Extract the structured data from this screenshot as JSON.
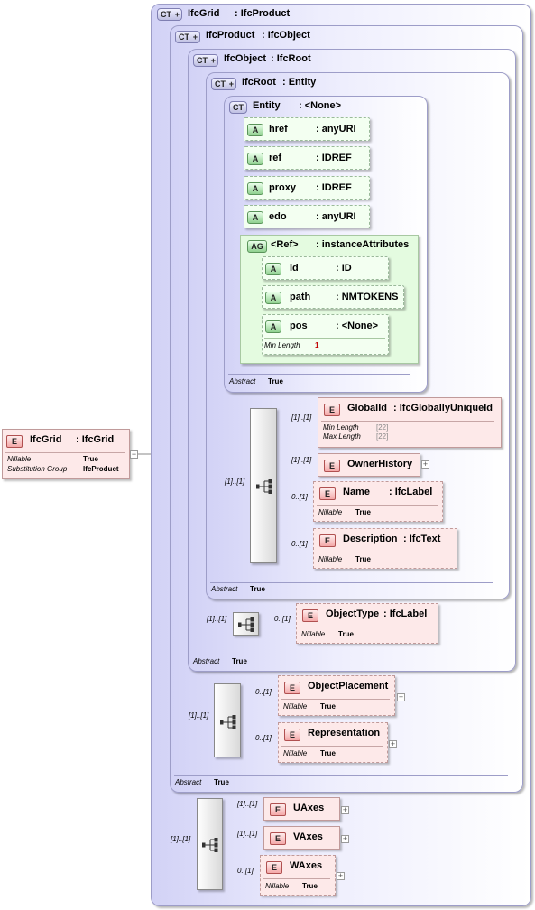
{
  "root_element": {
    "badge": "E",
    "name": "IfcGrid",
    "type": ": IfcGrid",
    "props": [
      {
        "label": "Nillable",
        "value": "True"
      },
      {
        "label": "Substitution Group",
        "value": "IfcProduct"
      }
    ]
  },
  "complex_types": {
    "ifcgrid": {
      "badge": "CT",
      "title": "IfcGrid",
      "base": ": IfcProduct"
    },
    "ifcproduct": {
      "badge": "CT",
      "title": "IfcProduct",
      "base": ": IfcObject",
      "abstract_label": "Abstract",
      "abstract_value": "True"
    },
    "ifcobject": {
      "badge": "CT",
      "title": "IfcObject",
      "base": ": IfcRoot",
      "abstract_label": "Abstract",
      "abstract_value": "True"
    },
    "ifcroot": {
      "badge": "CT",
      "title": "IfcRoot",
      "base": ": Entity",
      "abstract_label": "Abstract",
      "abstract_value": "True"
    },
    "entity": {
      "badge": "CT",
      "title": "Entity",
      "base": ": <None>",
      "abstract_label": "Abstract",
      "abstract_value": "True"
    }
  },
  "entity_attributes": [
    {
      "badge": "A",
      "name": "href",
      "type": ": anyURI"
    },
    {
      "badge": "A",
      "name": "ref",
      "type": ": IDREF"
    },
    {
      "badge": "A",
      "name": "proxy",
      "type": ": IDREF"
    },
    {
      "badge": "A",
      "name": "edo",
      "type": ": anyURI"
    }
  ],
  "attribute_group": {
    "badge": "AG",
    "name": "<Ref>",
    "type": ": instanceAttributes",
    "attributes": [
      {
        "badge": "A",
        "name": "id",
        "type": ": ID"
      },
      {
        "badge": "A",
        "name": "path",
        "type": ": NMTOKENS"
      },
      {
        "badge": "A",
        "name": "pos",
        "type": ": <None>",
        "prop_label": "Min Length",
        "prop_value": "1"
      }
    ]
  },
  "ifcroot_sequence": {
    "cardinality": "[1]..[1]",
    "elements": [
      {
        "badge": "E",
        "card": "[1]..[1]",
        "name": "GlobalId",
        "type": ": IfcGloballyUniqueId",
        "props": [
          {
            "label": "Min Length",
            "value": "[22]"
          },
          {
            "label": "Max Length",
            "value": "[22]"
          }
        ]
      },
      {
        "badge": "E",
        "card": "[1]..[1]",
        "name": "OwnerHistory",
        "expand": "+"
      },
      {
        "badge": "E",
        "card": "0..[1]",
        "name": "Name",
        "type": ": IfcLabel",
        "props": [
          {
            "label": "Nillable",
            "value": "True"
          }
        ]
      },
      {
        "badge": "E",
        "card": "0..[1]",
        "name": "Description",
        "type": ": IfcText",
        "props": [
          {
            "label": "Nillable",
            "value": "True"
          }
        ]
      }
    ]
  },
  "ifcobject_sequence": {
    "cardinality": "[1]..[1]",
    "elements": [
      {
        "badge": "E",
        "card": "0..[1]",
        "name": "ObjectType",
        "type": ": IfcLabel",
        "props": [
          {
            "label": "Nillable",
            "value": "True"
          }
        ]
      }
    ]
  },
  "ifcproduct_sequence": {
    "cardinality": "[1]..[1]",
    "elements": [
      {
        "badge": "E",
        "card": "0..[1]",
        "name": "ObjectPlacement",
        "expand": "+",
        "props": [
          {
            "label": "Nillable",
            "value": "True"
          }
        ]
      },
      {
        "badge": "E",
        "card": "0..[1]",
        "name": "Representation",
        "expand": "+",
        "props": [
          {
            "label": "Nillable",
            "value": "True"
          }
        ]
      }
    ]
  },
  "ifcgrid_sequence": {
    "cardinality": "[1]..[1]",
    "elements": [
      {
        "badge": "E",
        "card": "[1]..[1]",
        "name": "UAxes",
        "expand": "+"
      },
      {
        "badge": "E",
        "card": "[1]..[1]",
        "name": "VAxes",
        "expand": "+"
      },
      {
        "badge": "E",
        "card": "0..[1]",
        "name": "WAxes",
        "expand": "+",
        "props": [
          {
            "label": "Nillable",
            "value": "True"
          }
        ]
      }
    ]
  },
  "root_collapse": "−",
  "colors": {
    "ct_fill": "#d2d2f6",
    "ct_border": "#9d9dc8",
    "element_fill": "#fde9e9",
    "attribute_fill": "#f3fff1",
    "attribute_group_fill": "#e4fbe0"
  }
}
